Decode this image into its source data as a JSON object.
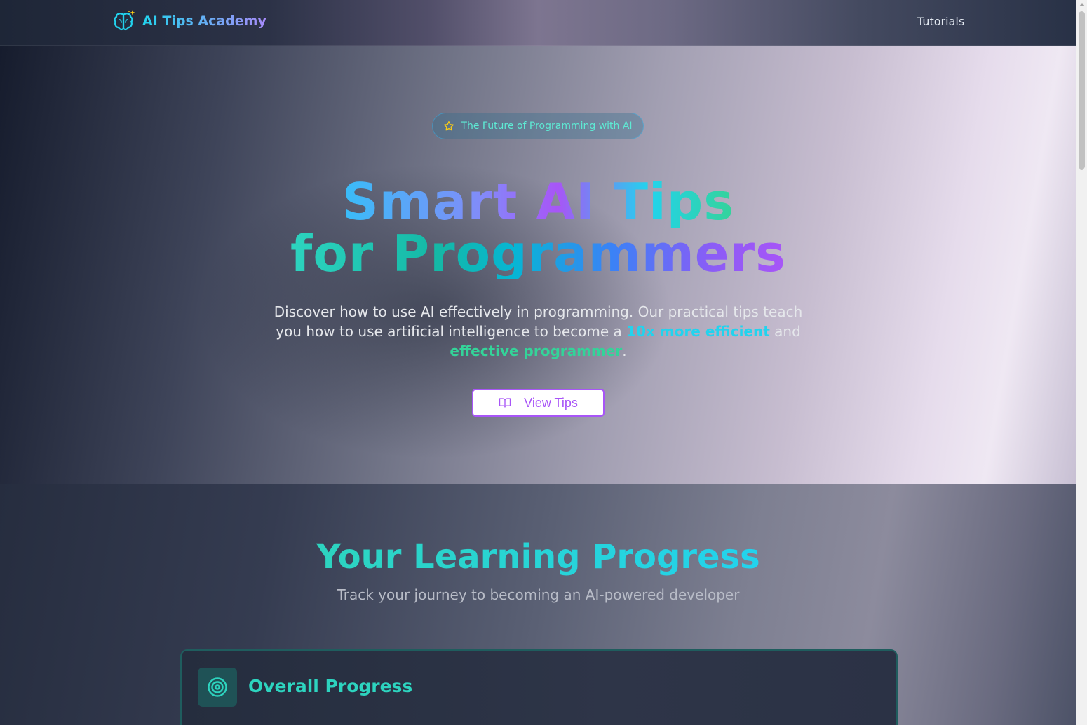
{
  "header": {
    "brand": "AI Tips Academy",
    "logo_icon": "brain-sparkle-icon",
    "nav": [
      {
        "label": "Tutorials"
      }
    ]
  },
  "hero": {
    "badge": "The Future of Programming with AI",
    "badge_icon": "star-icon",
    "title_line1": "Smart AI Tips",
    "title_line2": "for Programmers",
    "desc_part1": "Discover how to use AI effectively in programming. Our practical tips teach you how to use artificial intelligence to become a ",
    "desc_highlight1": "10x more efficient",
    "desc_part2": " and ",
    "desc_highlight2": "effective programmer",
    "desc_part3": ".",
    "cta_label": "View Tips",
    "cta_icon": "book-open-icon"
  },
  "progress": {
    "title": "Your Learning Progress",
    "subtitle": "Track your journey to becoming an AI-powered developer",
    "card_title": "Overall Progress",
    "card_icon": "target-icon"
  },
  "colors": {
    "accent_cyan": "#22d3ee",
    "accent_green": "#34d399",
    "accent_purple": "#a855f7",
    "accent_teal": "#2dd4bf"
  }
}
